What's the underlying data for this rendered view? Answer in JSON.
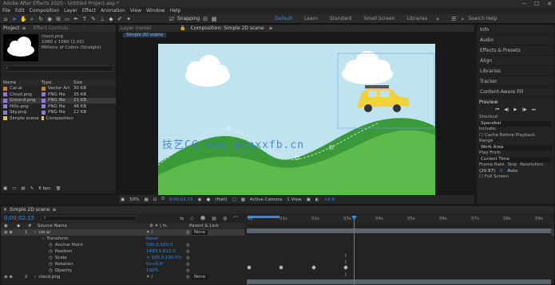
{
  "title_bar": {
    "text": "Adobe After Effects 2020 - Untitled Project.aep *"
  },
  "menu": [
    "File",
    "Edit",
    "Composition",
    "Layer",
    "Effect",
    "Animation",
    "View",
    "Window",
    "Help"
  ],
  "toolbar": {
    "snapping_label": "Snapping",
    "workspaces": [
      "Default",
      "Learn",
      "Standard",
      "Small Screen",
      "Libraries"
    ],
    "search_placeholder": "Search Help"
  },
  "project_panel": {
    "tab": "Project",
    "thumb_name": "cloud.png",
    "thumb_info1": "1080 x 1080 (1.00)",
    "thumb_info2": "Millions of Colors (Straight)",
    "search_placeholder": "",
    "columns": [
      "Name",
      "Type",
      "Size"
    ],
    "items": [
      {
        "name": "Car.ai",
        "type": "Vector Art",
        "size": "30 KB",
        "color": "#c87d3e"
      },
      {
        "name": "Cloud.png",
        "type": "PNG file",
        "size": "35 KB",
        "color": "#8a7fd1"
      },
      {
        "name": "Ground.png",
        "type": "PNG file",
        "size": "21 KB",
        "color": "#8a7fd1"
      },
      {
        "name": "Hills.png",
        "type": "PNG file",
        "size": "48 KB",
        "color": "#8a7fd1"
      },
      {
        "name": "Sky.png",
        "type": "PNG file",
        "size": "12 KB",
        "color": "#8a7fd1"
      },
      {
        "name": "Simple scene",
        "type": "Composition",
        "size": "",
        "color": "#d8c36a"
      }
    ],
    "footer_bpc": "8 bpc"
  },
  "effect_panel": {
    "tab": "Effect Controls"
  },
  "comp_panel": {
    "tab": "Composition: Simple 2D scene",
    "breadcrumb": "Simple 2D scene",
    "zoom": "50%",
    "timecode": "0;00;02;15",
    "quality": "(Half)",
    "camera": "Active Camera",
    "views": "1 View"
  },
  "watermark": "技艺CG  www.qdnxxfb.cn",
  "right_panel": {
    "items": [
      "Info",
      "Audio",
      "Effects & Presets",
      "Align",
      "Libraries",
      "Tracker",
      "Content-Aware Fill"
    ],
    "preview": {
      "title": "Preview",
      "shortcut_label": "Shortcut",
      "shortcut_value": "Spacebar",
      "include_label": "Include:",
      "cache_label": "Cache Before Playback",
      "range_label": "Range",
      "range_value": "Work Area",
      "play_from_label": "Play From",
      "play_from_value": "Current Time",
      "frame_rate_label": "Frame Rate",
      "skip_label": "Skip",
      "resolution_label": "Resolution",
      "frame_rate_value": "(29.97)",
      "skip_value": "0",
      "resolution_value": "Auto",
      "full_screen_label": "Full Screen"
    }
  },
  "timeline": {
    "tab": "Simple 2D scene",
    "timecode": "0;00;02;15",
    "search_placeholder": "",
    "col_source": "Source Name",
    "col_parent": "Parent & Link",
    "rows": [
      {
        "num": "1",
        "name": "car.ai",
        "parent": "None",
        "selected": true
      },
      {
        "num": "",
        "name": "Transform",
        "reset": "Reset"
      },
      {
        "num": "",
        "name": "Anchor Point",
        "value": "500.0,500.0"
      },
      {
        "num": "",
        "name": "Position",
        "value": "1493.5,612.0"
      },
      {
        "num": "",
        "name": "Scale",
        "value": "∞ 100.0,100.0%"
      },
      {
        "num": "",
        "name": "Rotation",
        "value": "0x+0.0°"
      },
      {
        "num": "",
        "name": "Opacity",
        "value": "100%"
      },
      {
        "num": "2",
        "name": "cloud.png",
        "parent": "None"
      }
    ],
    "ruler": [
      "0s",
      "01s",
      "02s",
      "03s",
      "04s",
      "05s",
      "06s",
      "07s",
      "08s",
      "09s"
    ],
    "playhead_sec": 2.5
  }
}
